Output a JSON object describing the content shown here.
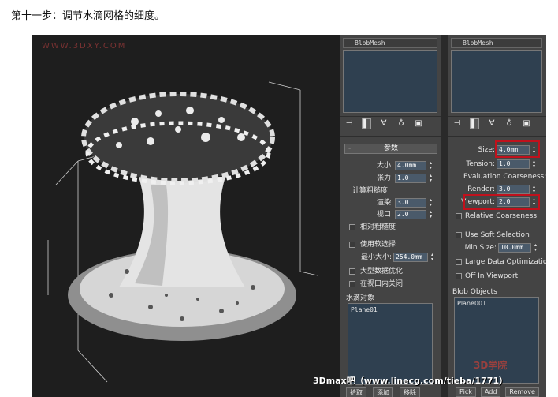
{
  "caption": "第十一步：调节水滴网格的细度。",
  "viewport": {
    "watermark": "WWW.3DXY.COM"
  },
  "panel_cn": {
    "name_field": "BlobMesh",
    "rollout_title": "参数",
    "size_label": "大小:",
    "size_value": "4.0mm",
    "tension_label": "张力:",
    "tension_value": "1.0",
    "coarseness_label": "计算粗糙度:",
    "render_label": "渲染:",
    "render_value": "3.0",
    "viewport_label": "视口:",
    "viewport_value": "2.0",
    "relative_coarseness": "相对粗糙度",
    "use_soft_selection": "使用软选择",
    "min_size_label": "最小大小:",
    "min_size_value": "254.0mm",
    "large_data": "大型数据优化",
    "off_in_viewport": "在视口内关闭",
    "blob_objects_label": "水滴对象",
    "blob_item": "Plane01",
    "btn_pick": "拾取",
    "btn_add": "添加",
    "btn_remove": "移除"
  },
  "panel_en": {
    "name_field": "BlobMesh",
    "size_label": "Size:",
    "size_value": "4.0mm",
    "tension_label": "Tension:",
    "tension_value": "1.0",
    "coarseness_label": "Evaluation Coarseness:",
    "render_label": "Render:",
    "render_value": "3.0",
    "viewport_label": "Viewport:",
    "viewport_value": "2.0",
    "relative_coarseness": "Relative Coarseness",
    "use_soft_selection": "Use Soft Selection",
    "min_size_label": "Min Size:",
    "min_size_value": "10.0mm",
    "large_data": "Large Data Optimization",
    "off_in_viewport": "Off In Viewport",
    "blob_objects_label": "Blob Objects",
    "blob_item": "Plane001",
    "btn_pick": "Pick",
    "btn_add": "Add",
    "btn_remove": "Remove"
  },
  "credit": "3Dmax吧（www.linecg.com/tieba/1771）",
  "logo": "3D学院",
  "highlight_color": "#c0111c"
}
